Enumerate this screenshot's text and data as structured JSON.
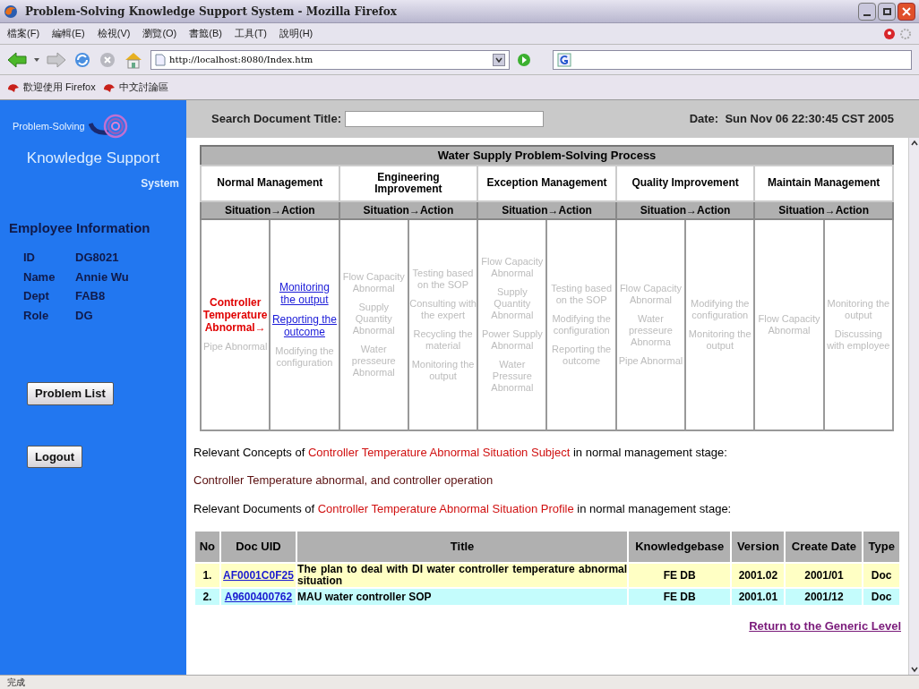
{
  "browser": {
    "title": "Problem-Solving Knowledge Support System - Mozilla Firefox",
    "menu": [
      "檔案(F)",
      "編輯(E)",
      "檢視(V)",
      "瀏覽(O)",
      "書籤(B)",
      "工具(T)",
      "說明(H)"
    ],
    "address": "http://localhost:8080/Index.htm",
    "bookmarks": [
      "歡迎使用 Firefox",
      "中文討論區"
    ],
    "status": "完成"
  },
  "sidebar": {
    "brand_top": "Problem-Solving",
    "brand_main": "Knowledge Support",
    "brand_sub": "System",
    "employee_heading": "Employee Information",
    "fields": [
      {
        "label": "ID",
        "value": "DG8021"
      },
      {
        "label": "Name",
        "value": "Annie Wu"
      },
      {
        "label": "Dept",
        "value": "FAB8"
      },
      {
        "label": "Role",
        "value": "DG"
      }
    ],
    "buttons": [
      "Problem List",
      "Logout"
    ]
  },
  "search": {
    "label": "Search Document Title:"
  },
  "date": {
    "label": "Date:",
    "value": "Sun Nov 06 22:30:45 CST 2005"
  },
  "process": {
    "title": "Water Supply Problem-Solving Process",
    "stages": [
      {
        "name": "Normal Management",
        "subheader": "Situation→Action",
        "situations": [
          {
            "text": "Controller Temperature Abnormal→",
            "kind": "current"
          },
          {
            "text": "Pipe Abnormal",
            "kind": "inactive"
          }
        ],
        "actions": [
          {
            "text": "Monitoring the output",
            "kind": "link"
          },
          {
            "text": "Reporting the outcome",
            "kind": "link"
          },
          {
            "text": "Modifying the configuration",
            "kind": "inactive"
          }
        ]
      },
      {
        "name": "Engineering Improvement",
        "subheader": "Situation→Action",
        "situations": [
          {
            "text": "Flow Capacity Abnormal",
            "kind": "inactive"
          },
          {
            "text": "Supply Quantity Abnormal",
            "kind": "inactive"
          },
          {
            "text": "Water presseure Abnormal",
            "kind": "inactive"
          }
        ],
        "actions": [
          {
            "text": "Testing based on the SOP",
            "kind": "inactive"
          },
          {
            "text": "Consulting with the expert",
            "kind": "inactive"
          },
          {
            "text": "Recycling the material",
            "kind": "inactive"
          },
          {
            "text": "Monitoring the output",
            "kind": "inactive"
          }
        ]
      },
      {
        "name": "Exception Management",
        "subheader": "Situation→Action",
        "situations": [
          {
            "text": "Flow Capacity Abnormal",
            "kind": "inactive"
          },
          {
            "text": "Supply Quantity Abnormal",
            "kind": "inactive"
          },
          {
            "text": "Power Supply Abnormal",
            "kind": "inactive"
          },
          {
            "text": "Water Pressure Abnormal",
            "kind": "inactive"
          }
        ],
        "actions": [
          {
            "text": "Testing based on the SOP",
            "kind": "inactive"
          },
          {
            "text": "Modifying the configuration",
            "kind": "inactive"
          },
          {
            "text": "Reporting the outcome",
            "kind": "inactive"
          }
        ]
      },
      {
        "name": "Quality Improvement",
        "subheader": "Situation→Action",
        "situations": [
          {
            "text": "Flow Capacity Abnormal",
            "kind": "inactive"
          },
          {
            "text": "Water presseure Abnorma",
            "kind": "inactive"
          },
          {
            "text": "Pipe Abnormal",
            "kind": "inactive"
          }
        ],
        "actions": [
          {
            "text": "Modifying the configuration",
            "kind": "inactive"
          },
          {
            "text": "Monitoring the output",
            "kind": "inactive"
          }
        ]
      },
      {
        "name": "Maintain Management",
        "subheader": "Situation→Action",
        "situations": [
          {
            "text": "Flow Capacity Abnormal",
            "kind": "inactive"
          }
        ],
        "actions": [
          {
            "text": "Monitoring the output",
            "kind": "inactive"
          },
          {
            "text": "Discussing with employee",
            "kind": "inactive"
          }
        ]
      }
    ]
  },
  "concepts_line": {
    "prefix": "Relevant Concepts of ",
    "highlight": "Controller Temperature Abnormal Situation Subject",
    "suffix": " in normal management stage:"
  },
  "concepts_result": "Controller Temperature abnormal, and controller operation",
  "documents_line": {
    "prefix": "Relevant Documents of ",
    "highlight": "Controller Temperature Abnormal Situation Profile",
    "suffix": " in normal management stage:"
  },
  "documents": {
    "columns": [
      "No",
      "Doc UID",
      "Title",
      "Knowledgebase",
      "Version",
      "Create Date",
      "Type"
    ],
    "rows": [
      {
        "no": "1.",
        "uid": "AF0001C0F25",
        "title": "The plan to deal with DI water controller temperature abnormal situation",
        "knowledgebase": "FE DB",
        "version": "2001.02",
        "date": "2001/01",
        "type": "Doc",
        "color": "#ffffc4"
      },
      {
        "no": "2.",
        "uid": "A9600400762",
        "title": "MAU water controller SOP",
        "knowledgebase": "FE DB",
        "version": "2001.01",
        "date": "2001/12",
        "type": "Doc",
        "color": "#c4fcfc"
      }
    ]
  },
  "return_link": "Return to the Generic Level"
}
